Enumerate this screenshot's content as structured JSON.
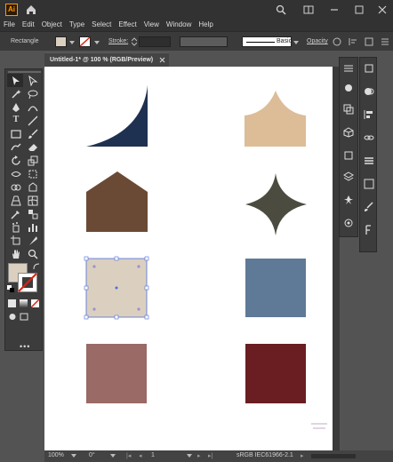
{
  "app": {
    "logo": "Ai",
    "menu": [
      "File",
      "Edit",
      "Object",
      "Type",
      "Select",
      "Effect",
      "View",
      "Window",
      "Help"
    ],
    "icons": [
      "home-icon",
      "search-icon",
      "arrange-documents-icon",
      "minimize-icon",
      "maximize-icon",
      "close-icon"
    ]
  },
  "control_bar": {
    "selection_label": "Rectangle",
    "stroke_label": "Stroke:",
    "brush_label": "Basic",
    "opacity_label": "Opacity",
    "fill_color": "#dbd0bf"
  },
  "document": {
    "tab_title": "Untitled-1* @ 100 % (RGB/Preview)"
  },
  "canvas": {
    "shapes": [
      {
        "name": "quarter-curve-shape",
        "color": "#1f3150"
      },
      {
        "name": "arch-top-shape",
        "color": "#dcbd98"
      },
      {
        "name": "pentagon-house-shape",
        "color": "#6b4a35"
      },
      {
        "name": "four-point-star-shape",
        "color": "#4b4b40"
      },
      {
        "name": "selected-rectangle",
        "color": "#dbd0bf"
      },
      {
        "name": "blue-square",
        "color": "#5f7a96"
      },
      {
        "name": "rose-square",
        "color": "#9a6a66"
      },
      {
        "name": "maroon-square",
        "color": "#6a1e22"
      }
    ]
  },
  "status_bar": {
    "zoom": "100%",
    "rotation": "0°",
    "artboard": "1",
    "color_profile": "sRGB IEC61966-2.1"
  }
}
